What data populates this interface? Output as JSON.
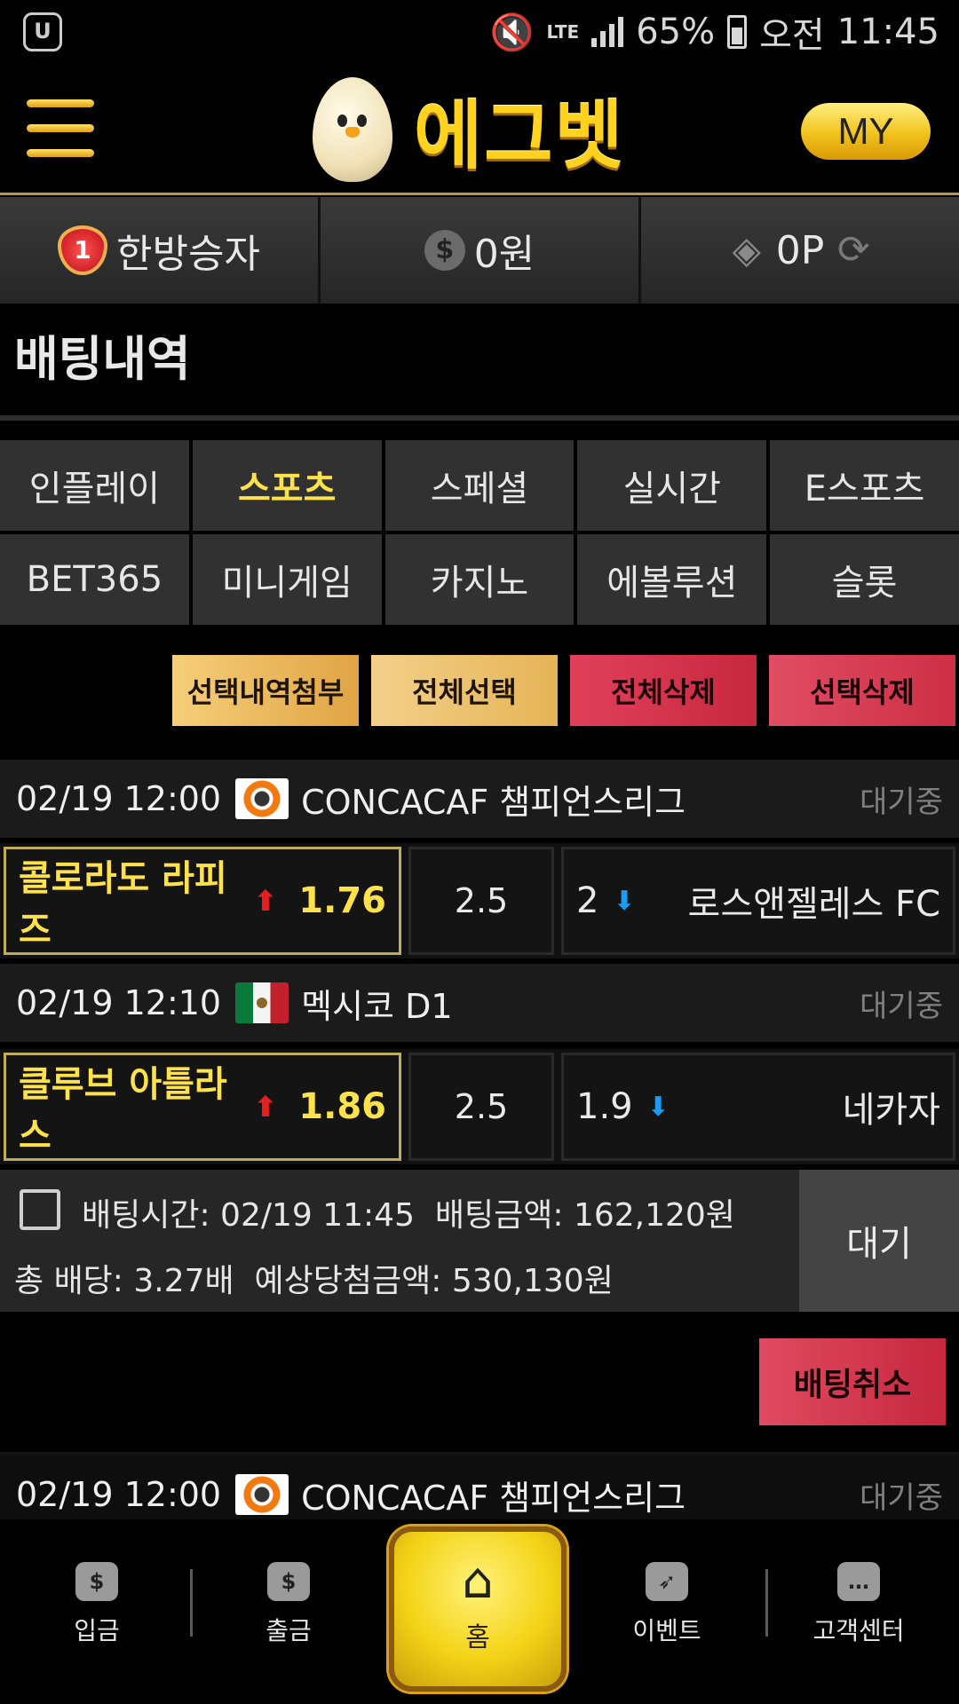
{
  "status_bar": {
    "battery": "65%",
    "period": "오전",
    "time": "11:45",
    "network": "LTE"
  },
  "header": {
    "brand": "에그벳",
    "my_label": "MY"
  },
  "user_bar": {
    "rank_number": "1",
    "nickname": "한방승자",
    "money": "0원",
    "points": "0P"
  },
  "page": {
    "title": "배팅내역"
  },
  "tabs": [
    {
      "label": "인플레이"
    },
    {
      "label": "스포츠",
      "active": true
    },
    {
      "label": "스페셜"
    },
    {
      "label": "실시간"
    },
    {
      "label": "E스포츠"
    },
    {
      "label": "BET365"
    },
    {
      "label": "미니게임"
    },
    {
      "label": "카지노"
    },
    {
      "label": "에볼루션"
    },
    {
      "label": "슬롯"
    }
  ],
  "actions": {
    "attach": "선택내역첨부",
    "select_all": "전체선택",
    "delete_all": "전체삭제",
    "delete_selected": "선택삭제"
  },
  "bets": [
    {
      "time": "02/19 12:00",
      "league": "CONCACAF 챔피언스리그",
      "status": "대기중",
      "home_team": "콜로라도 라피즈",
      "home_odds": "1.76",
      "draw": "2.5",
      "away_odds": "2",
      "away_team": "로스앤젤레스 FC"
    },
    {
      "time": "02/19 12:10",
      "league": "멕시코 D1",
      "status": "대기중",
      "home_team": "클루브 아틀라스",
      "home_odds": "1.86",
      "draw": "2.5",
      "away_odds": "1.9",
      "away_team": "네카자"
    }
  ],
  "summary": {
    "bet_time": "배팅시간: 02/19 11:45",
    "bet_amount": "배팅금액: 162,120원",
    "total_odds": "총 배당: 3.27배",
    "expected_win": "예상당첨금액: 530,130원",
    "status": "대기",
    "cancel_label": "배팅취소"
  },
  "next_bet": {
    "time": "02/19 12:00",
    "league": "CONCACAF 챔피언스리그",
    "status": "대기중"
  },
  "bottom_nav": {
    "deposit": "입금",
    "withdraw": "출금",
    "home": "홈",
    "event": "이벤트",
    "support": "고객센터"
  },
  "colors": {
    "accent_gold": "#ffe24a",
    "danger_red": "#d2334a",
    "background": "#000000"
  }
}
